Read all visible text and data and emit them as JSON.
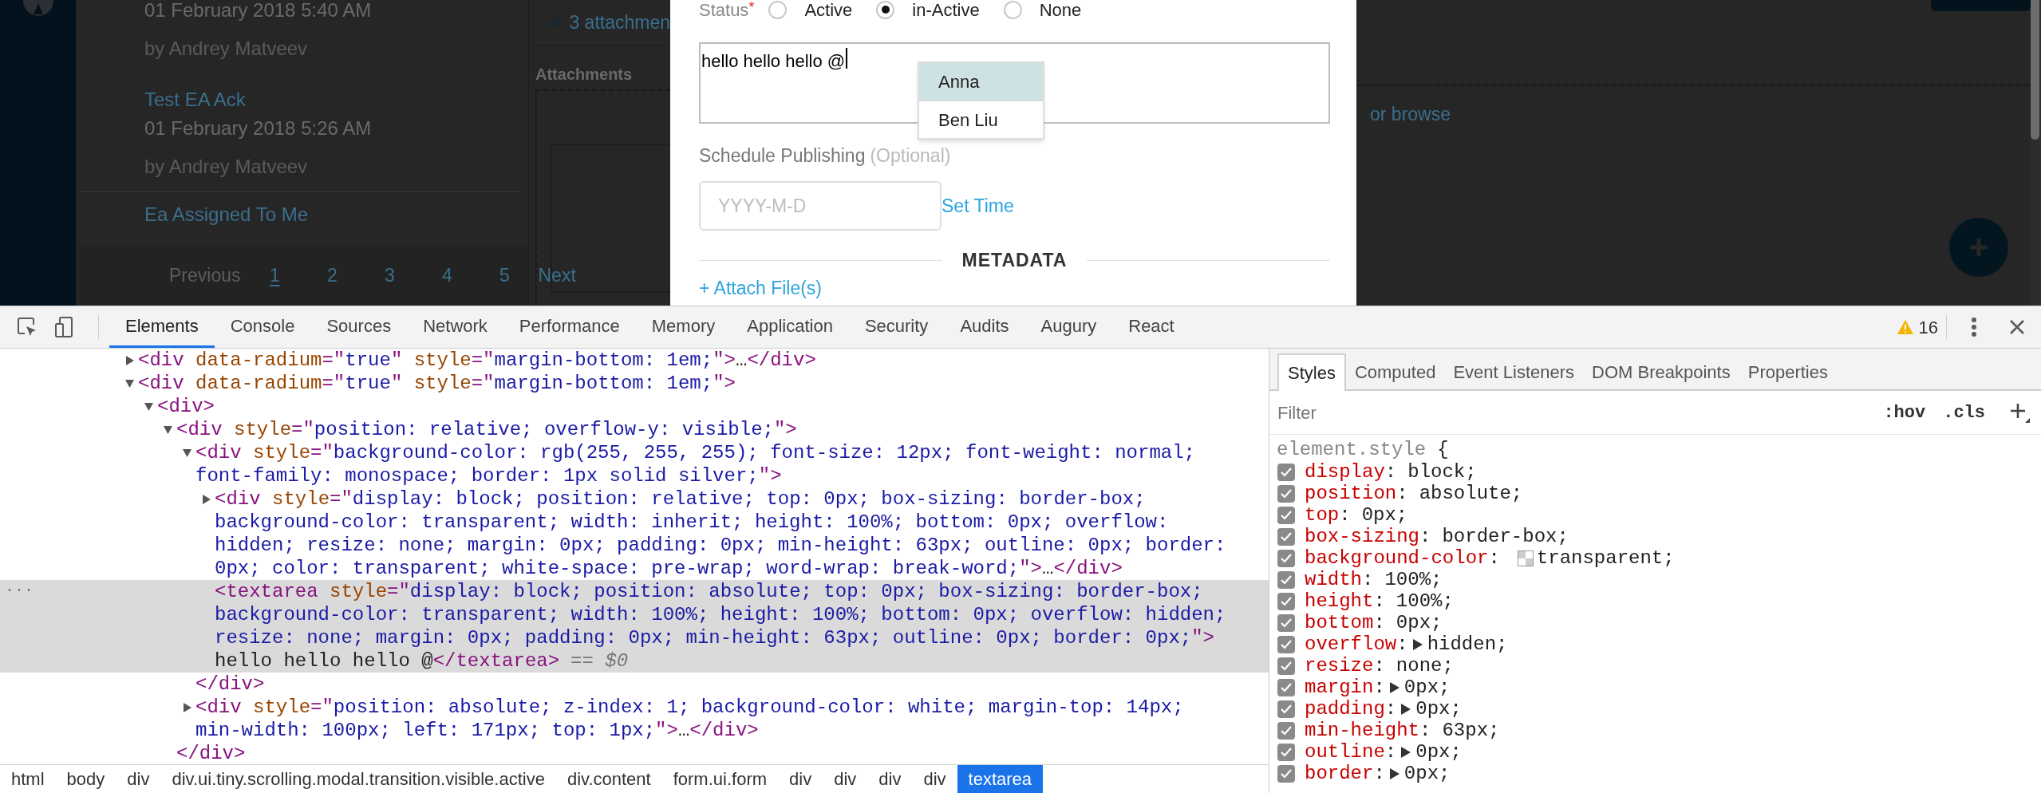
{
  "feed": {
    "items": [
      {
        "date": "01 February 2018 5:40 AM",
        "author": "by Andrey Matveev",
        "separated": false
      },
      {
        "title": "Test EA Ack",
        "date": "01 February 2018 5:26 AM",
        "author": "by Andrey Matveev",
        "separated": false
      },
      {
        "title": "Ea Assigned To Me",
        "separated": true
      }
    ],
    "pagination": {
      "previous": {
        "label": "Previous",
        "disabled": true
      },
      "pages": [
        {
          "label": "1",
          "selected": true
        },
        {
          "label": "2",
          "selected": false
        },
        {
          "label": "3",
          "selected": false
        },
        {
          "label": "4",
          "selected": false
        },
        {
          "label": "5",
          "selected": false
        }
      ],
      "next": {
        "label": "Next",
        "disabled": false
      }
    }
  },
  "attachments_panel": {
    "link": "3 attachmen",
    "heading": "Attachments",
    "browse": "or browse"
  },
  "modal": {
    "status": {
      "label": "Status",
      "required_mark": "*",
      "options": [
        {
          "label": "Active",
          "selected": false
        },
        {
          "label": "in-Active",
          "selected": true
        },
        {
          "label": "None",
          "selected": false
        }
      ]
    },
    "message": {
      "value": "hello hello hello @",
      "focused": true
    },
    "mention_menu": [
      {
        "label": "Anna",
        "selected": true
      },
      {
        "label": "Ben Liu",
        "selected": false
      }
    ],
    "schedule": {
      "label": "Schedule Publishing",
      "hint": "(Optional)",
      "date_placeholder": "YYYY-M-D",
      "time_link": "Set Time"
    },
    "section_heading": "METADATA",
    "attach_link": "+ Attach File(s)"
  },
  "devtools": {
    "tabs": [
      {
        "label": "Elements",
        "selected": true
      },
      {
        "label": "Console",
        "selected": false
      },
      {
        "label": "Sources",
        "selected": false
      },
      {
        "label": "Network",
        "selected": false
      },
      {
        "label": "Performance",
        "selected": false
      },
      {
        "label": "Memory",
        "selected": false
      },
      {
        "label": "Application",
        "selected": false
      },
      {
        "label": "Security",
        "selected": false
      },
      {
        "label": "Audits",
        "selected": false
      },
      {
        "label": "Augury",
        "selected": false
      },
      {
        "label": "React",
        "selected": false
      }
    ],
    "warnings": "16",
    "dom_tree": [
      {
        "text": "<div data-radium=\"true\" style=\"margin-bottom: 1em;\">…</div>",
        "expanded": false,
        "selected": false
      },
      {
        "text": "<div data-radium=\"true\" style=\"margin-bottom: 1em;\">",
        "expanded": true,
        "selected": false,
        "children": [
          {
            "text": "<div>",
            "expanded": true,
            "selected": false,
            "children": [
              {
                "text": "<div style=\"position: relative; overflow-y: visible;\">",
                "expanded": true,
                "selected": false,
                "close": "</div>",
                "children": [
                  {
                    "text": "<div style=\"background-color: rgb(255, 255, 255); font-size: 12px; font-weight: normal; font-family: monospace; border: 1px solid silver;\">",
                    "expanded": true,
                    "selected": false,
                    "close": "</div>",
                    "children": [
                      {
                        "text": "<div style=\"display: block; position: relative; top: 0px; box-sizing: border-box; background-color: transparent; width: inherit; height: 100%; bottom: 0px; overflow: hidden; resize: none; margin: 0px; padding: 0px; min-height: 63px; outline: 0px; border: 0px; color: transparent; white-space: pre-wrap; word-wrap: break-word;\">…</div>",
                        "expanded": false,
                        "selected": false
                      },
                      {
                        "text": "<textarea style=\"display: block; position: absolute; top: 0px; box-sizing: border-box; background-color: transparent; width: 100%; height: 100%; bottom: 0px; overflow: hidden; resize: none; margin: 0px; padding: 0px; min-height: 63px; outline: 0px; border: 0px;\">",
                        "content": "hello hello hello @</textarea>",
                        "selected": true,
                        "gutter": "...",
                        "suffix": "== $0"
                      }
                    ]
                  },
                  {
                    "text": "<div style=\"position: absolute; z-index: 1; background-color: white; margin-top: 14px; min-width: 100px; left: 171px; top: 1px;\">…</div>",
                    "expanded": false,
                    "selected": false
                  }
                ]
              }
            ]
          }
        ]
      }
    ],
    "breadcrumbs": [
      {
        "label": "html",
        "selected": false
      },
      {
        "label": "body",
        "selected": false
      },
      {
        "label": "div",
        "selected": false
      },
      {
        "label": "div.ui.tiny.scrolling.modal.transition.visible.active",
        "selected": false
      },
      {
        "label": "div.content",
        "selected": false
      },
      {
        "label": "form.ui.form",
        "selected": false
      },
      {
        "label": "div",
        "selected": false
      },
      {
        "label": "div",
        "selected": false
      },
      {
        "label": "div",
        "selected": false
      },
      {
        "label": "div",
        "selected": false
      },
      {
        "label": "textarea",
        "selected": true
      }
    ],
    "sidebar_tabs": [
      {
        "label": "Styles",
        "selected": true
      },
      {
        "label": "Computed",
        "selected": false
      },
      {
        "label": "Event Listeners",
        "selected": false
      },
      {
        "label": "DOM Breakpoints",
        "selected": false
      },
      {
        "label": "Properties",
        "selected": false
      }
    ],
    "filter": {
      "placeholder": "Filter"
    },
    "filter_buttons": [
      ":hov",
      ".cls"
    ],
    "styles": {
      "selector": "element.style",
      "brace": "{",
      "properties": [
        {
          "name": "display:",
          "value": "block;",
          "checked": true,
          "kind": "plain"
        },
        {
          "name": "position:",
          "value": "absolute;",
          "checked": true,
          "kind": "plain"
        },
        {
          "name": "top:",
          "value": "0px;",
          "checked": true,
          "kind": "plain"
        },
        {
          "name": "box-sizing:",
          "value": "border-box;",
          "checked": true,
          "kind": "plain"
        },
        {
          "name": "background-color:",
          "value": "transparent;",
          "checked": true,
          "kind": "color"
        },
        {
          "name": "width:",
          "value": "100%;",
          "checked": true,
          "kind": "plain"
        },
        {
          "name": "height:",
          "value": "100%;",
          "checked": true,
          "kind": "plain"
        },
        {
          "name": "bottom:",
          "value": "0px;",
          "checked": true,
          "kind": "plain"
        },
        {
          "name": "overflow:",
          "value": "hidden;",
          "checked": true,
          "kind": "shorthand"
        },
        {
          "name": "resize:",
          "value": "none;",
          "checked": true,
          "kind": "plain"
        },
        {
          "name": "margin:",
          "value": "0px;",
          "checked": true,
          "kind": "shorthand"
        },
        {
          "name": "padding:",
          "value": "0px;",
          "checked": true,
          "kind": "shorthand"
        },
        {
          "name": "min-height:",
          "value": "63px;",
          "checked": true,
          "kind": "plain"
        },
        {
          "name": "outline:",
          "value": "0px;",
          "checked": true,
          "kind": "shorthand"
        },
        {
          "name": "border:",
          "value": "0px;",
          "checked": true,
          "kind": "shorthand"
        }
      ]
    }
  }
}
